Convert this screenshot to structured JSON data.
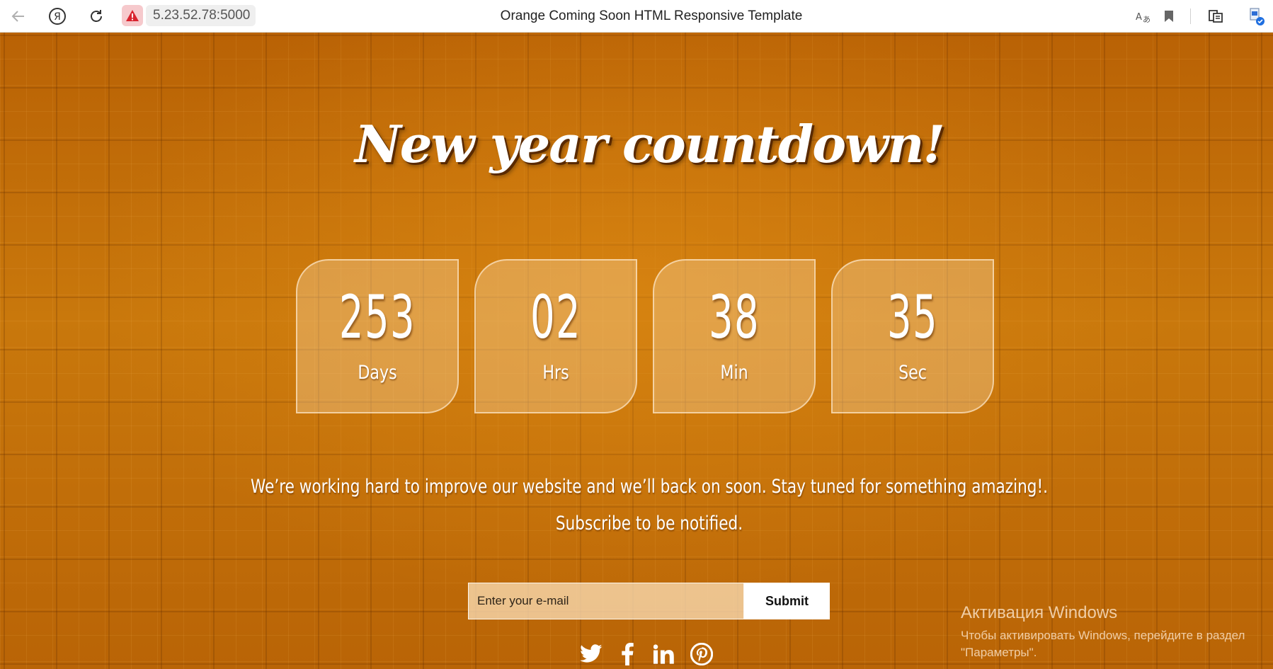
{
  "browser": {
    "url": "5.23.52.78:5000",
    "title": "Orange Coming Soon HTML Responsive Template",
    "icons": [
      "back-icon",
      "yandex-icon",
      "reload-icon",
      "warning-icon",
      "translate-icon",
      "bookmark-icon",
      "reading-mode-icon",
      "profile-icon"
    ]
  },
  "page": {
    "headline": "New year countdown!",
    "countdown": [
      {
        "value": "253",
        "label": "Days"
      },
      {
        "value": "02",
        "label": "Hrs"
      },
      {
        "value": "38",
        "label": "Min"
      },
      {
        "value": "35",
        "label": "Sec"
      }
    ],
    "message_line1": "We’re working hard to improve our website and we’ll back on soon. Stay tuned for something amazing!.",
    "message_line2": "Subscribe to be notified.",
    "form": {
      "email_placeholder": "Enter your e-mail",
      "submit_label": "Submit"
    },
    "social": [
      "twitter-icon",
      "facebook-icon",
      "linkedin-icon",
      "pinterest-icon"
    ]
  },
  "watermark": {
    "title": "Активация Windows",
    "line1": "Чтобы активировать Windows, перейдите в раздел",
    "line2": "\"Параметры\"."
  },
  "colors": {
    "background": "#c06a07",
    "warning_bg": "#f6c9cc",
    "warning_icon": "#d9232e"
  }
}
